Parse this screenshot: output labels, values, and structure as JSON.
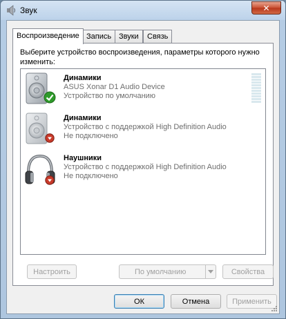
{
  "window": {
    "title": "Звук",
    "close_label": "✕"
  },
  "tabs": [
    {
      "label": "Воспроизведение",
      "active": true
    },
    {
      "label": "Запись",
      "active": false
    },
    {
      "label": "Звуки",
      "active": false
    },
    {
      "label": "Связь",
      "active": false
    }
  ],
  "panel": {
    "instruction": "Выберите устройство воспроизведения, параметры которого нужно изменить:"
  },
  "devices": [
    {
      "name": "Динамики",
      "line1": "ASUS Xonar D1 Audio Device",
      "line2": "Устройство по умолчанию",
      "icon": "speaker-icon",
      "status": "default-check"
    },
    {
      "name": "Динамики",
      "line1": "Устройство с поддержкой High Definition Audio",
      "line2": "Не подключено",
      "icon": "speaker-icon",
      "status": "disconnected"
    },
    {
      "name": "Наушники",
      "line1": "Устройство с поддержкой High Definition Audio",
      "line2": "Не подключено",
      "icon": "headphones-icon",
      "status": "disconnected"
    }
  ],
  "panel_buttons": {
    "configure": "Настроить",
    "set_default": "По умолчанию",
    "properties": "Свойства"
  },
  "dialog_buttons": {
    "ok": "ОК",
    "cancel": "Отмена",
    "apply": "Применить"
  },
  "colors": {
    "accent": "#3c7fb1",
    "check": "#2e9a2a",
    "disconnected": "#c83a2a"
  }
}
